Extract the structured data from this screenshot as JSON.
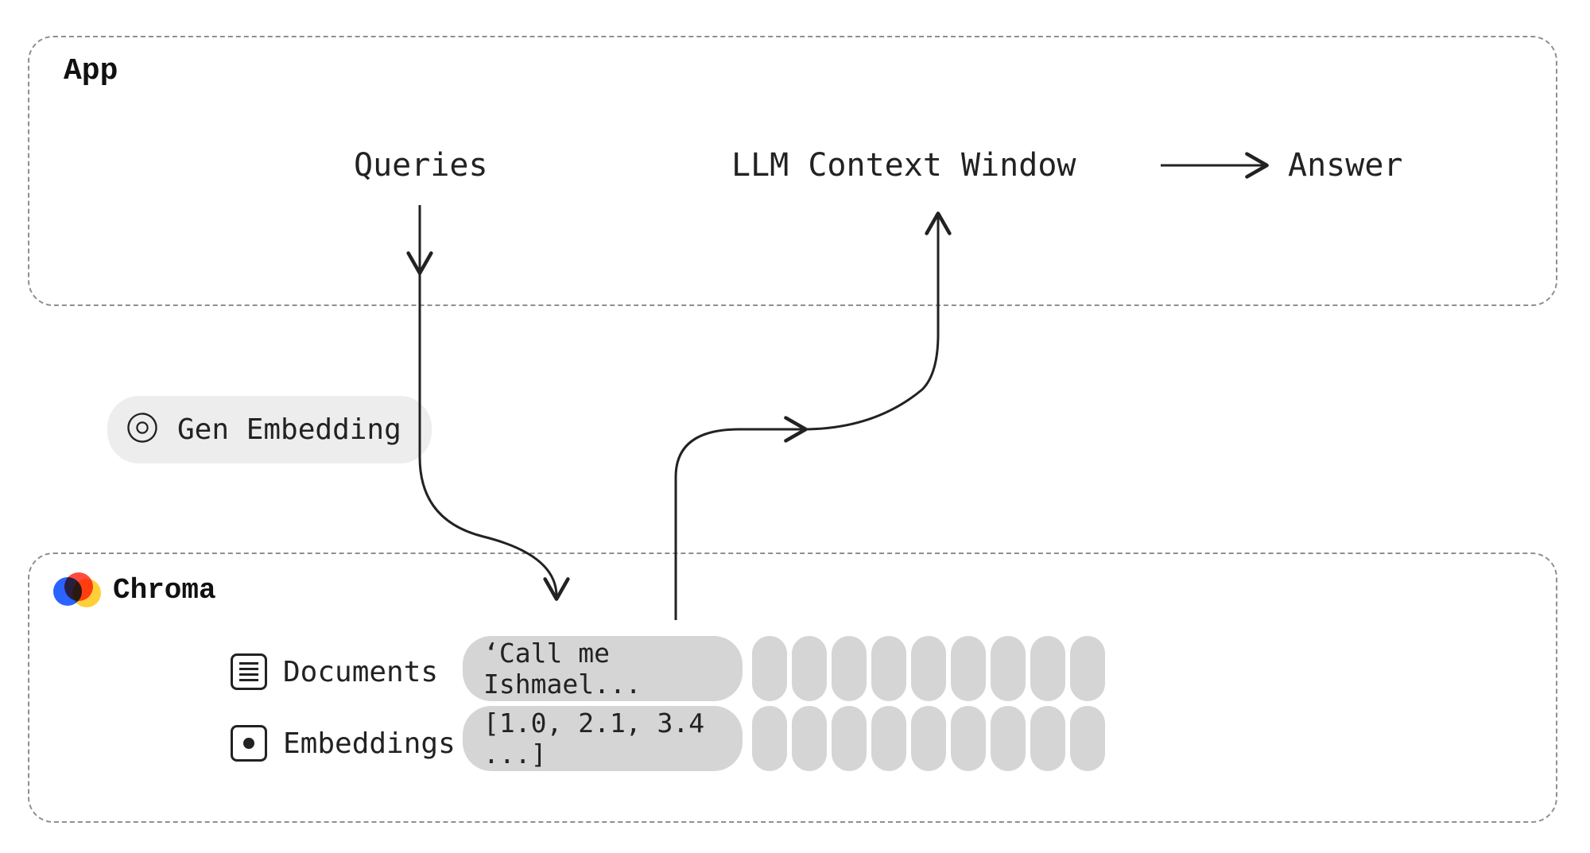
{
  "app": {
    "title": "App",
    "queries_label": "Queries",
    "context_label": "LLM Context Window",
    "answer_label": "Answer"
  },
  "gen_embedding": {
    "label": "Gen Embedding"
  },
  "chroma": {
    "title": "Chroma",
    "documents_label": "Documents",
    "embeddings_label": "Embeddings",
    "document_example": "‘Call me Ishmael...",
    "embedding_example": "[1.0, 2.1, 3.4 ...]"
  }
}
